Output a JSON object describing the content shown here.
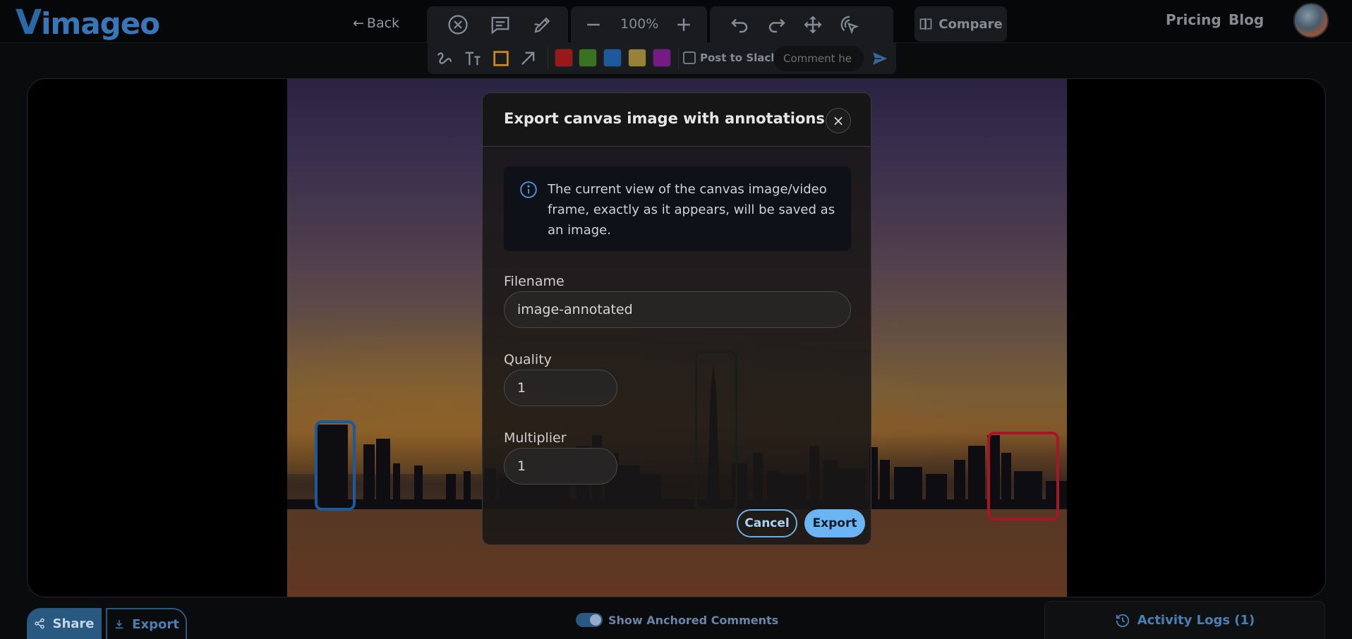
{
  "header": {
    "logo_v": "V",
    "logo_rest": "imageo",
    "back_label": "Back",
    "zoom_level": "100%",
    "compare_label": "Compare",
    "nav": {
      "pricing": "Pricing",
      "blog": "Blog"
    }
  },
  "annotation_toolbar": {
    "post_to_slack_label": "Post to Slack",
    "comment_placeholder": "Comment he",
    "colors": [
      "#a31a1a",
      "#3e7a22",
      "#1f5fa6",
      "#a08a3a",
      "#7d1d8e"
    ]
  },
  "annotations": {
    "blue_color": "#1d5fa6",
    "red_color": "#b0182a",
    "green_color": "#2e4a24"
  },
  "modal": {
    "title": "Export canvas image with annotations",
    "close_glyph": "×",
    "info_text": "The current view of the canvas image/video frame, exactly as it appears, will be saved as an image.",
    "filename_label": "Filename",
    "filename_value": "image-annotated",
    "quality_label": "Quality",
    "quality_value": "1",
    "multiplier_label": "Multiplier",
    "multiplier_value": "1",
    "cancel_label": "Cancel",
    "confirm_label": "Export"
  },
  "bottom": {
    "share_label": "Share",
    "export_label": "Export",
    "anchored_label": "Show Anchored Comments",
    "activity_label": "Activity Logs (1)"
  },
  "icons": {
    "back": "arrow-left-icon",
    "clear": "circle-x-icon",
    "comment": "message-square-icon",
    "draw": "pen-edit-icon",
    "zoom_out": "minus-icon",
    "zoom_in": "plus-icon",
    "undo": "undo-icon",
    "redo": "redo-icon",
    "move": "move-arrows-icon",
    "cursor": "pointer-click-icon",
    "compare": "compare-icon",
    "freehand": "squiggle-icon",
    "text": "text-tool-icon",
    "rectangle": "square-icon",
    "arrow": "arrow-up-right-icon",
    "send": "send-icon",
    "info": "info-icon",
    "share": "share-icon",
    "download": "download-icon",
    "history": "history-icon"
  }
}
